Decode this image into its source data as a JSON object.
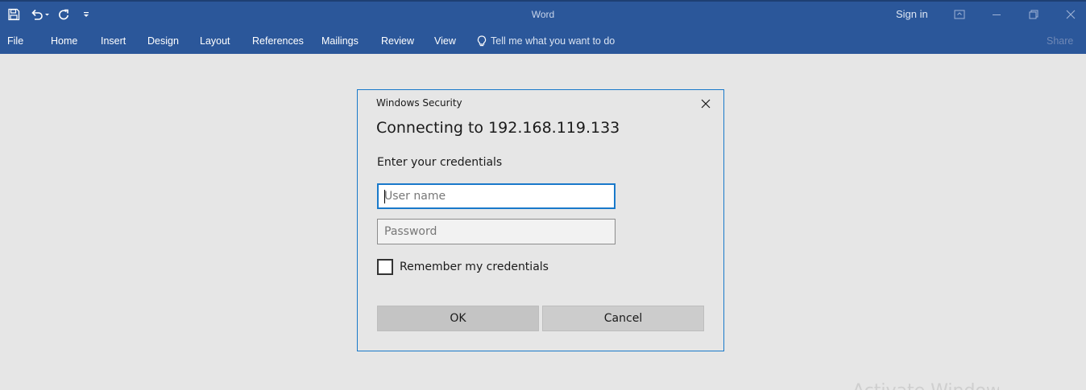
{
  "window": {
    "title": "Word",
    "sign_in": "Sign in",
    "colors": {
      "titlebar": "#2b579a",
      "accent": "#1979ca"
    }
  },
  "quick_access": {
    "icons": [
      "save-icon",
      "undo-icon",
      "redo-icon",
      "customize-icon"
    ]
  },
  "ribbon": {
    "tabs": [
      "File",
      "Home",
      "Insert",
      "Design",
      "Layout",
      "References",
      "Mailings",
      "Review",
      "View"
    ],
    "tell_me": "Tell me what you want to do",
    "share": "Share"
  },
  "dialog": {
    "caption": "Windows Security",
    "heading": "Connecting to 192.168.119.133",
    "prompt": "Enter your credentials",
    "username": {
      "value": "",
      "placeholder": "User name"
    },
    "password": {
      "value": "",
      "placeholder": "Password"
    },
    "remember_label": "Remember my credentials",
    "remember_checked": false,
    "ok_label": "OK",
    "cancel_label": "Cancel"
  },
  "watermark": "Activate Windows"
}
